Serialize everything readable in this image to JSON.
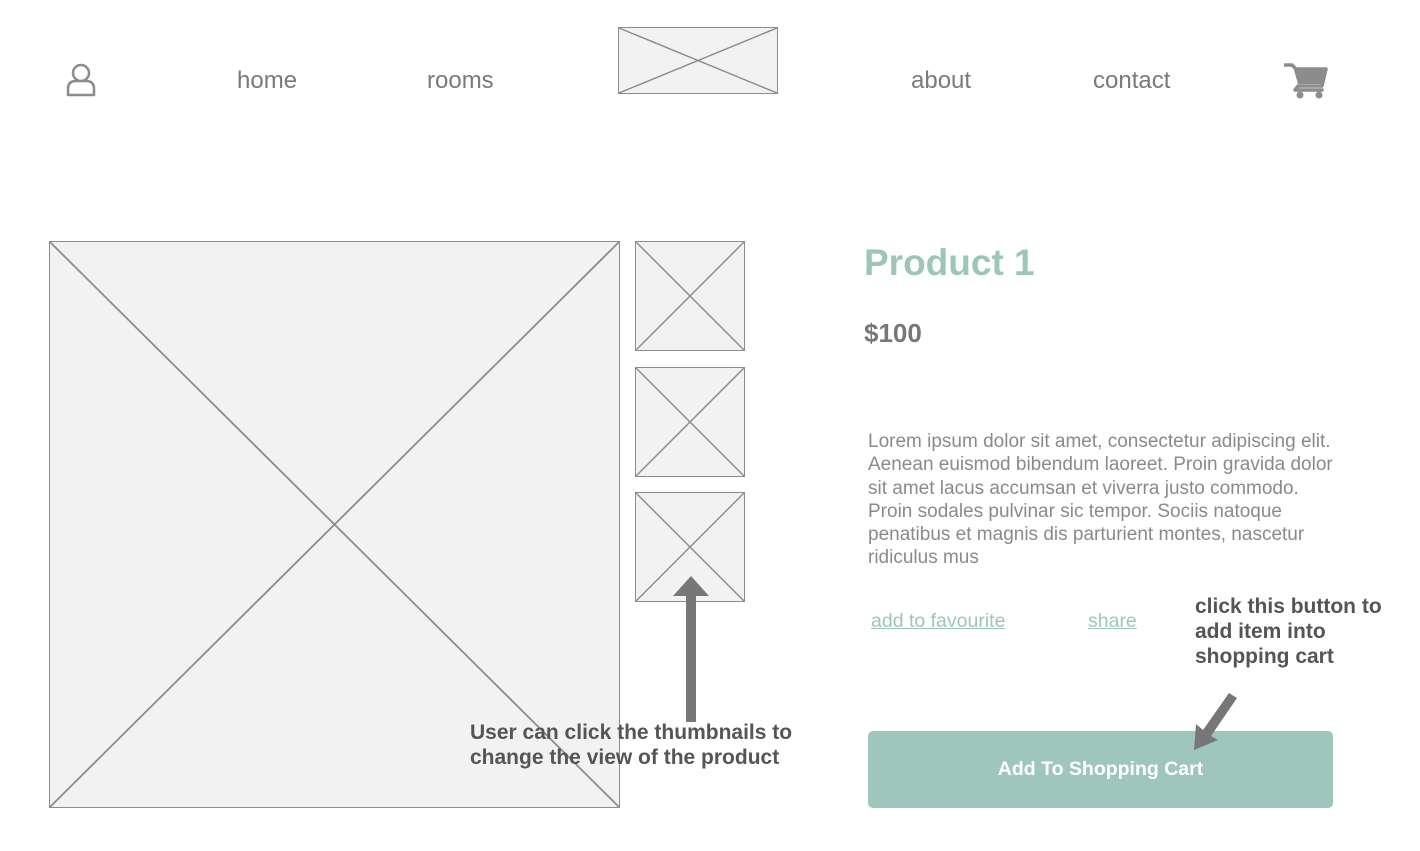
{
  "nav": {
    "user_icon": "user-icon",
    "home": "home",
    "rooms": "rooms",
    "logo": "logo-placeholder",
    "about": "about",
    "contact": "contact",
    "cart_icon": "shopping-cart-icon"
  },
  "product": {
    "title": "Product 1",
    "price": "$100",
    "description": "Lorem ipsum dolor sit amet, consectetur adipiscing elit. Aenean euismod bibendum laoreet. Proin gravida dolor sit amet lacus accumsan et viverra justo commodo. Proin sodales pulvinar sic tempor. Sociis natoque penatibus et magnis dis parturient montes, nascetur ridiculus mus",
    "add_to_favourite": "add to favourite",
    "share": "share",
    "add_to_cart": "Add To Shopping Cart"
  },
  "annotations": {
    "thumbnails_note_line1": "User can click the thumbnails to",
    "thumbnails_note_line2": "change the view of the product",
    "cart_note_line1": "click this button to",
    "cart_note_line2": "add item into",
    "cart_note_line3": "shopping cart"
  },
  "colors": {
    "accent": "#9fc6bc",
    "text_gray": "#7a7a7a",
    "placeholder_fill": "#f2f2f2"
  }
}
